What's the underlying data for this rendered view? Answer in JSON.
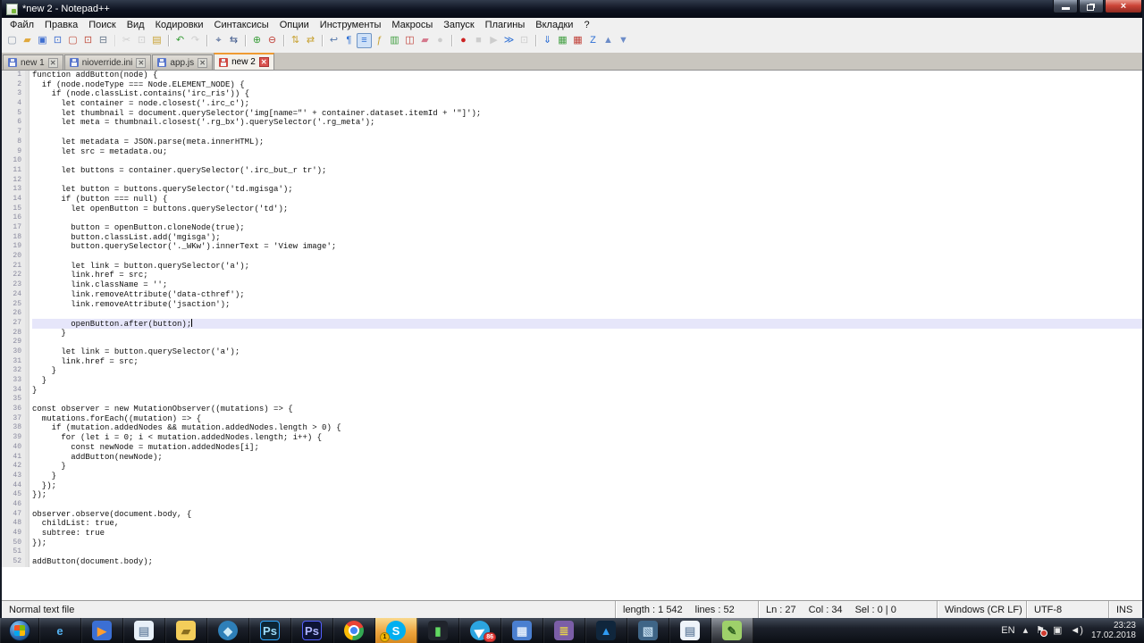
{
  "window": {
    "title": "*new 2 - Notepad++",
    "controls": {
      "close_glyph": "×"
    }
  },
  "menu": {
    "items": [
      {
        "name": "menu-file",
        "label": "Файл"
      },
      {
        "name": "menu-edit",
        "label": "Правка"
      },
      {
        "name": "menu-search",
        "label": "Поиск"
      },
      {
        "name": "menu-view",
        "label": "Вид"
      },
      {
        "name": "menu-encoding",
        "label": "Кодировки"
      },
      {
        "name": "menu-language",
        "label": "Синтаксисы"
      },
      {
        "name": "menu-settings",
        "label": "Опции"
      },
      {
        "name": "menu-tools",
        "label": "Инструменты"
      },
      {
        "name": "menu-macro",
        "label": "Макросы"
      },
      {
        "name": "menu-run",
        "label": "Запуск"
      },
      {
        "name": "menu-plugins",
        "label": "Плагины"
      },
      {
        "name": "menu-window",
        "label": "Вкладки"
      },
      {
        "name": "menu-help",
        "label": "?"
      }
    ]
  },
  "toolbar": {
    "buttons": [
      {
        "name": "new-file-button",
        "glyph": "▢",
        "color": "#8a97a8"
      },
      {
        "name": "open-file-button",
        "glyph": "▰",
        "color": "#e0a83c"
      },
      {
        "name": "save-button",
        "glyph": "▣",
        "color": "#3f6fd0"
      },
      {
        "name": "save-all-button",
        "glyph": "⊡",
        "color": "#3f6fd0"
      },
      {
        "name": "close-file-button",
        "glyph": "▢",
        "color": "#c05040"
      },
      {
        "name": "close-all-button",
        "glyph": "⊡",
        "color": "#c05040"
      },
      {
        "name": "print-button",
        "glyph": "⊟",
        "color": "#68788c"
      },
      {
        "name": "cut-button",
        "glyph": "✂",
        "color": "#9a9a9a",
        "enabled": false,
        "sep": true
      },
      {
        "name": "copy-button",
        "glyph": "⊡",
        "color": "#9a9a9a",
        "enabled": false
      },
      {
        "name": "paste-button",
        "glyph": "▤",
        "color": "#c8a232"
      },
      {
        "name": "undo-button",
        "glyph": "↶",
        "color": "#3a9e3a",
        "sep": true
      },
      {
        "name": "redo-button",
        "glyph": "↷",
        "color": "#9a9a9a",
        "enabled": false
      },
      {
        "name": "find-button",
        "glyph": "⌖",
        "color": "#405a8c",
        "sep": true
      },
      {
        "name": "replace-button",
        "glyph": "⇆",
        "color": "#405a8c"
      },
      {
        "name": "zoom-in-button",
        "glyph": "⊕",
        "color": "#3a9e3a",
        "sep": true
      },
      {
        "name": "zoom-out-button",
        "glyph": "⊖",
        "color": "#c04038"
      },
      {
        "name": "sync-vertical-scroll-button",
        "glyph": "⇅",
        "color": "#c8a232",
        "sep": true
      },
      {
        "name": "sync-horizontal-scroll-button",
        "glyph": "⇄",
        "color": "#c8a232"
      },
      {
        "name": "word-wrap-button",
        "glyph": "↩",
        "color": "#5578aa",
        "sep": true
      },
      {
        "name": "show-all-characters-button",
        "glyph": "¶",
        "color": "#2d6fd4"
      },
      {
        "name": "show-indent-guide-button",
        "glyph": "≡",
        "color": "#2d6fd4",
        "pressed": true
      },
      {
        "name": "function-list-button",
        "glyph": "ƒ",
        "color": "#c8a232"
      },
      {
        "name": "document-map-button",
        "glyph": "▥",
        "color": "#44a044"
      },
      {
        "name": "document-switcher-button",
        "glyph": "◫",
        "color": "#c04038"
      },
      {
        "name": "folder-as-workspace-button",
        "glyph": "▰",
        "color": "#d4788c"
      },
      {
        "name": "monitoring-button",
        "glyph": "●",
        "color": "#9a9a9a",
        "enabled": false
      },
      {
        "name": "macro-record-button",
        "glyph": "●",
        "color": "#cc2222",
        "sep": true
      },
      {
        "name": "macro-stop-button",
        "glyph": "■",
        "color": "#9a9a9a",
        "enabled": false
      },
      {
        "name": "macro-play-button",
        "glyph": "▶",
        "color": "#9a9a9a",
        "enabled": false
      },
      {
        "name": "macro-save-button",
        "glyph": "≫",
        "color": "#2d6fd4"
      },
      {
        "name": "macro-run-multiple-button",
        "glyph": "⊡",
        "color": "#9a9a9a",
        "enabled": false
      },
      {
        "name": "plugin-changed-lines-button",
        "glyph": "⇓",
        "color": "#2d6fd4",
        "sep": true
      },
      {
        "name": "plugin-compare-button",
        "glyph": "▦",
        "color": "#44a044"
      },
      {
        "name": "plugin-compare-clear-button",
        "glyph": "▦",
        "color": "#c04038"
      },
      {
        "name": "plugin-nav-last-button",
        "glyph": "Z",
        "color": "#2d6fd4"
      },
      {
        "name": "plugin-nav-up-button",
        "glyph": "▲",
        "color": "#6c8cc8"
      },
      {
        "name": "plugin-nav-down-button",
        "glyph": "▼",
        "color": "#6c8cc8"
      }
    ]
  },
  "tabs": [
    {
      "name": "tab-new-1",
      "label": "new 1",
      "state": "saved",
      "close_glyph": "✕"
    },
    {
      "name": "tab-nioverride-ini",
      "label": "nioverride.ini",
      "state": "saved",
      "close_glyph": "✕"
    },
    {
      "name": "tab-app-js",
      "label": "app.js",
      "state": "saved",
      "close_glyph": "✕"
    },
    {
      "name": "tab-new-2",
      "label": "new 2",
      "state": "modified",
      "active": true,
      "close_glyph": "✕"
    }
  ],
  "editor": {
    "current_line": 27,
    "lines": [
      "function addButton(node) {",
      "  if (node.nodeType === Node.ELEMENT_NODE) {",
      "    if (node.classList.contains('irc_ris')) {",
      "      let container = node.closest('.irc_c');",
      "      let thumbnail = document.querySelector('img[name=\"' + container.dataset.itemId + '\"]');",
      "      let meta = thumbnail.closest('.rg_bx').querySelector('.rg_meta');",
      "",
      "      let metadata = JSON.parse(meta.innerHTML);",
      "      let src = metadata.ou;",
      "",
      "      let buttons = container.querySelector('.irc_but_r tr');",
      "",
      "      let button = buttons.querySelector('td.mgisga');",
      "      if (button === null) {",
      "        let openButton = buttons.querySelector('td');",
      "",
      "        button = openButton.cloneNode(true);",
      "        button.classList.add('mgisga');",
      "        button.querySelector('._WKw').innerText = 'View image';",
      "",
      "        let link = button.querySelector('a');",
      "        link.href = src;",
      "        link.className = '';",
      "        link.removeAttribute('data-cthref');",
      "        link.removeAttribute('jsaction');",
      "",
      "        openButton.after(button);",
      "      }",
      "",
      "      let link = button.querySelector('a');",
      "      link.href = src;",
      "    }",
      "  }",
      "}",
      "",
      "const observer = new MutationObserver((mutations) => {",
      "  mutations.forEach((mutation) => {",
      "    if (mutation.addedNodes && mutation.addedNodes.length > 0) {",
      "      for (let i = 0; i < mutation.addedNodes.length; i++) {",
      "        const newNode = mutation.addedNodes[i];",
      "        addButton(newNode);",
      "      }",
      "    }",
      "  });",
      "});",
      "",
      "observer.observe(document.body, {",
      "  childList: true,",
      "  subtree: true",
      "});",
      "",
      "addButton(document.body);"
    ]
  },
  "status": {
    "doc_type": "Normal text file",
    "length": "length : 1 542",
    "lines": "lines : 52",
    "ln": "Ln : 27",
    "col": "Col : 34",
    "sel": "Sel : 0 | 0",
    "eol": "Windows (CR LF)",
    "encoding": "UTF-8",
    "insert_mode": "INS"
  },
  "taskbar": {
    "apps": [
      {
        "name": "start-button",
        "type": "start",
        "glyph": ""
      },
      {
        "name": "internet-explorer-icon",
        "glyph": "e",
        "fg": "#53b1f0",
        "bg": "transparent"
      },
      {
        "name": "media-player-icon",
        "glyph": "▶",
        "fg": "#ff9d2e",
        "bg": "#3b6fd4"
      },
      {
        "name": "notepad-icon",
        "glyph": "▤",
        "fg": "#7c93ad",
        "bg": "#e8f0f8"
      },
      {
        "name": "file-explorer-icon",
        "glyph": "▰",
        "fg": "#8a6d1f",
        "bg": "#f3cd5a"
      },
      {
        "name": "daemon-tools-icon",
        "glyph": "◆",
        "fg": "#cdeaf7",
        "bg": "#2e7fb8",
        "shape": "circle"
      },
      {
        "name": "photoshop-cyan-icon",
        "glyph": "Ps",
        "fg": "#9ddcf9",
        "bg": "#0d2635",
        "border": "#31a8ff"
      },
      {
        "name": "photoshop-blue-icon",
        "glyph": "Ps",
        "fg": "#b0b6ff",
        "bg": "#0d1335",
        "border": "#5560ff"
      },
      {
        "name": "chrome-icon",
        "type": "chrome",
        "glyph": ""
      },
      {
        "name": "skype-icon",
        "glyph": "S",
        "fg": "#ffffff",
        "bg": "#00aff0",
        "shape": "circle",
        "attention": true,
        "badge": "1",
        "badge_color": "#f0b400",
        "badge_fg": "#3a2a00",
        "badge_pos": "bl"
      },
      {
        "name": "system-monitor-icon",
        "glyph": "▮",
        "fg": "#62d962",
        "bg": "#20242c"
      },
      {
        "name": "telegram-icon",
        "glyph": "▶",
        "fg": "#ffffff",
        "bg": "#2ca5e0",
        "shape": "circle",
        "rotate": -30,
        "badge": "86",
        "badge_color": "#e53935",
        "badge_fg": "#ffffff",
        "badge_pos": "br"
      },
      {
        "name": "calculator-icon",
        "glyph": "▦",
        "fg": "#dce8f8",
        "bg": "#4a7fd0"
      },
      {
        "name": "winrar-icon",
        "glyph": "≣",
        "fg": "#e8d44a",
        "bg": "#7b5ea7"
      },
      {
        "name": "affinity-designer-icon",
        "glyph": "▲",
        "fg": "#2f9bf3",
        "bg": "#10263c"
      },
      {
        "name": "image-viewer-icon",
        "glyph": "▧",
        "fg": "#bcd7ea",
        "bg": "#3f6586"
      },
      {
        "name": "notepad-alt-icon",
        "glyph": "▤",
        "fg": "#7c93ad",
        "bg": "#eef4fa"
      },
      {
        "name": "notepad-plus-plus-icon",
        "glyph": "✎",
        "fg": "#2c5e1e",
        "bg": "#9ed06a",
        "active": true
      }
    ],
    "tray": {
      "lang": "EN",
      "chevron": "▴",
      "flag": "⚑",
      "network": "▣",
      "volume": "◄)",
      "time": "23:23",
      "date": "17.02.2018"
    }
  }
}
